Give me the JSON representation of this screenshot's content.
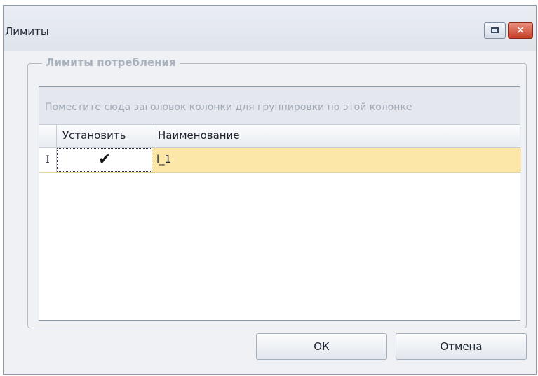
{
  "window": {
    "title": "Лимиты",
    "close_glyph": "✕",
    "restore_icon": "restore-icon"
  },
  "group": {
    "legend": "Лимиты потребления"
  },
  "grid": {
    "group_hint": "Поместите сюда заголовок колонки для группировки по этой колонке",
    "columns": [
      "Установить",
      "Наименование"
    ],
    "rows": [
      {
        "indicator": "I",
        "install_checked": true,
        "install_glyph": "✔",
        "name": "l_1"
      }
    ]
  },
  "buttons": {
    "ok": "ОК",
    "cancel": "Отмена"
  },
  "colors": {
    "selected_row": "#fde7a8",
    "close_button": "#c6402a"
  }
}
